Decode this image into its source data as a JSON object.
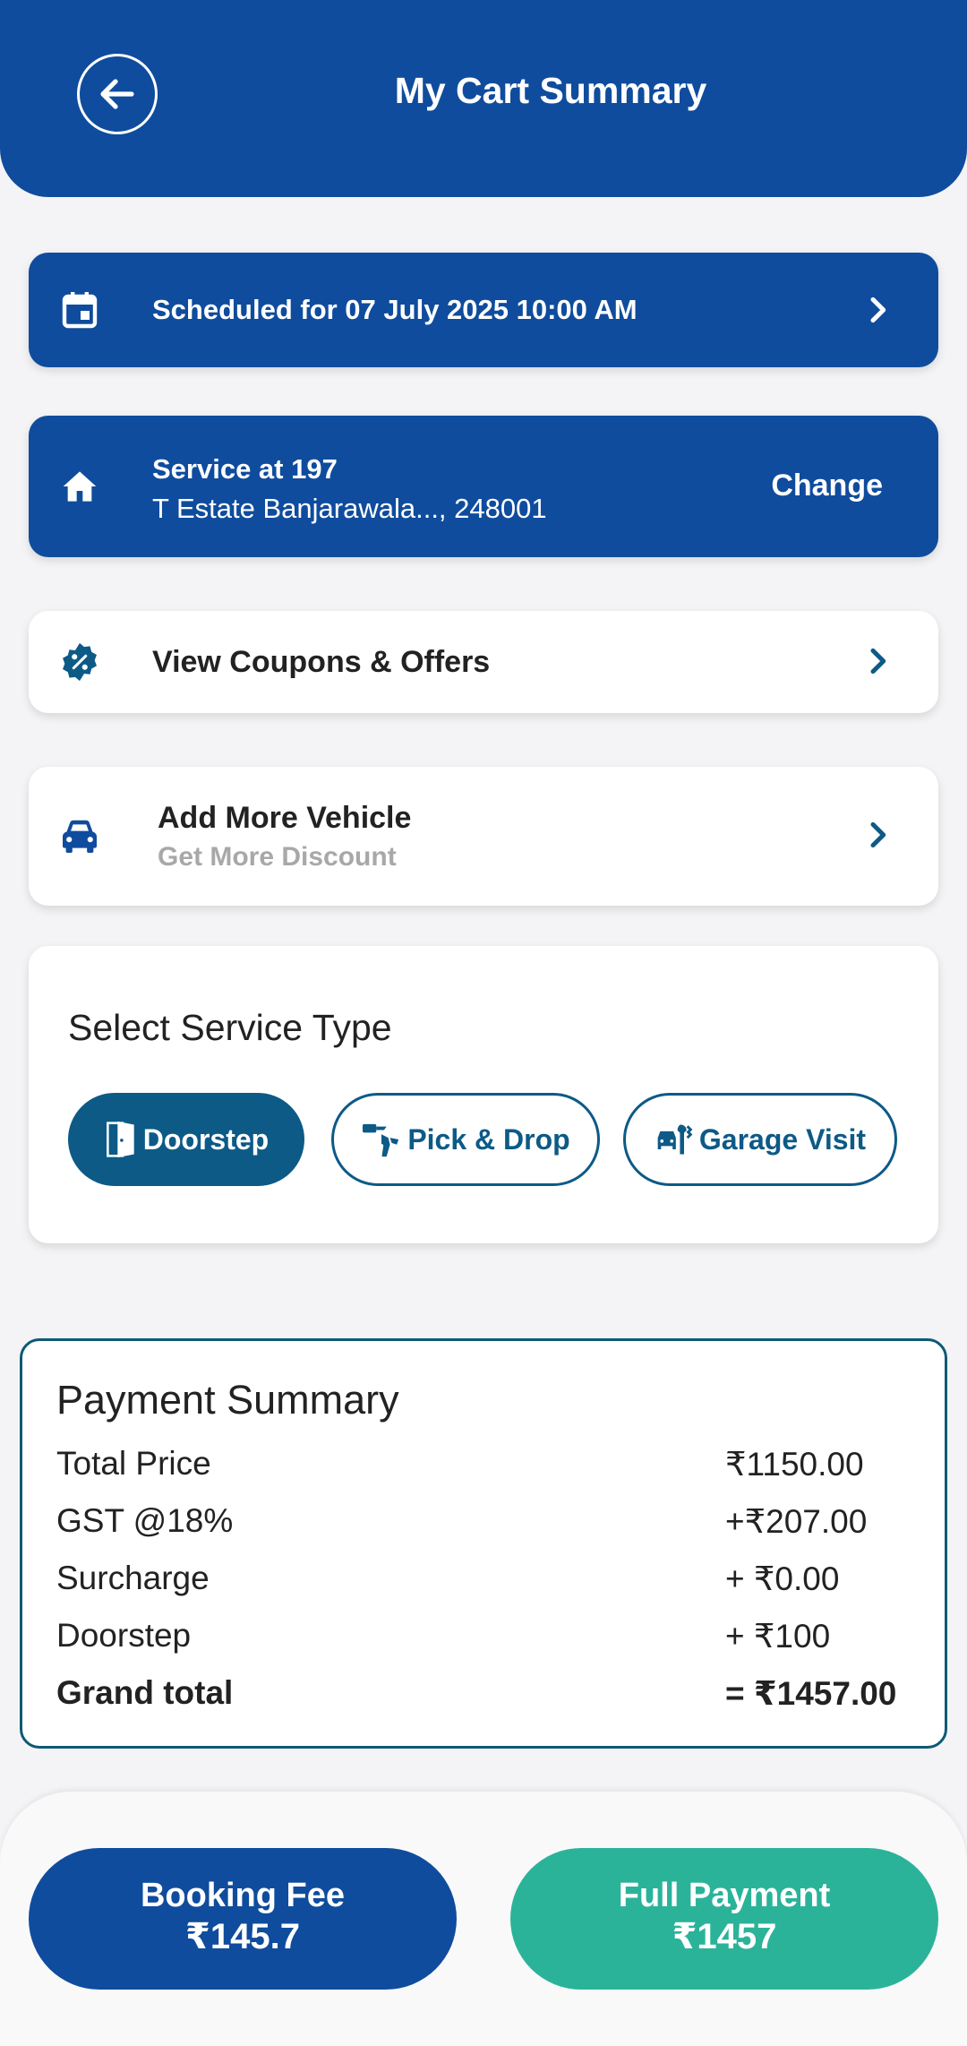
{
  "header": {
    "title": "My Cart Summary",
    "back_icon": "arrow-left-icon"
  },
  "schedule": {
    "text": "Scheduled for 07 July 2025 10:00 AM",
    "icon": "calendar-icon"
  },
  "address": {
    "line1": "Service at 197",
    "line2": "T Estate Banjarawala..., 248001",
    "change_label": "Change",
    "icon": "home-icon"
  },
  "coupons": {
    "label": "View Coupons & Offers",
    "icon": "discount-badge-icon"
  },
  "vehicle": {
    "title": "Add More Vehicle",
    "subtitle": "Get More Discount",
    "icon": "car-icon"
  },
  "service_type": {
    "title": "Select Service Type",
    "options": [
      {
        "label": "Doorstep",
        "selected": true,
        "icon": "door-icon"
      },
      {
        "label": "Pick & Drop",
        "selected": false,
        "icon": "key-hand-icon"
      },
      {
        "label": "Garage Visit",
        "selected": false,
        "icon": "car-tools-icon"
      }
    ]
  },
  "payment_summary": {
    "title": "Payment Summary",
    "rows": [
      {
        "label": "Total Price",
        "value": "₹1150.00"
      },
      {
        "label": "GST @18%",
        "value": "+₹207.00"
      },
      {
        "label": "Surcharge",
        "value": "+ ₹0.00"
      },
      {
        "label": "Doorstep",
        "value": "+ ₹100"
      },
      {
        "label": "Grand total",
        "value": "= ₹1457.00"
      }
    ]
  },
  "actions": {
    "booking": {
      "label": "Booking Fee",
      "amount": "₹145.7"
    },
    "full": {
      "label": "Full Payment",
      "amount": "₹1457"
    }
  },
  "colors": {
    "primary": "#0f4c9d",
    "teal": "#0d5a86",
    "green": "#2bb39a",
    "background": "#f4f4f6"
  }
}
